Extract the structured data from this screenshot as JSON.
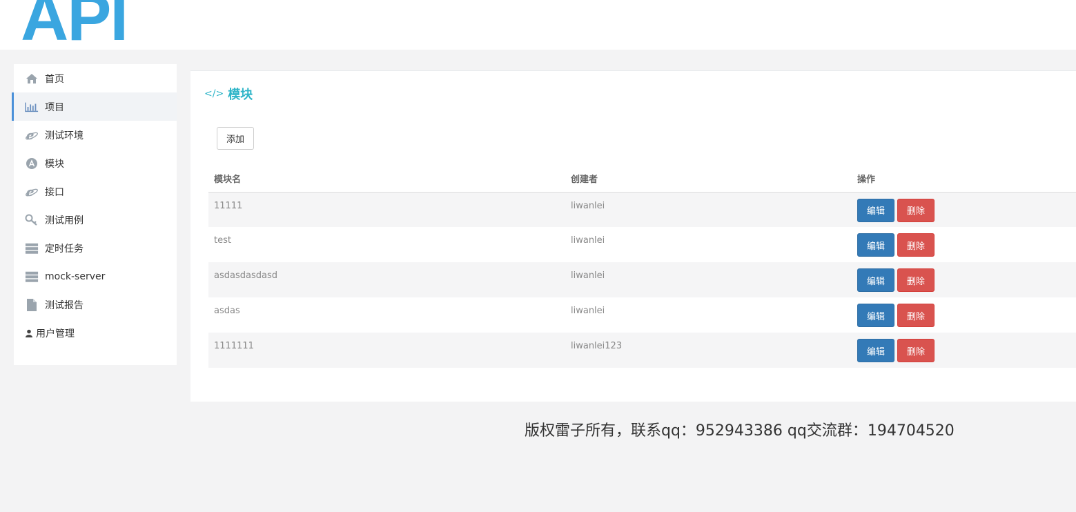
{
  "header": {
    "logo_text": "API"
  },
  "sidebar": {
    "items": [
      {
        "label": "首页",
        "icon": "home-icon"
      },
      {
        "label": "项目",
        "icon": "bar-chart-icon"
      },
      {
        "label": "测试环境",
        "icon": "ie-icon"
      },
      {
        "label": "模块",
        "icon": "app-store-icon"
      },
      {
        "label": "接口",
        "icon": "ie-icon"
      },
      {
        "label": "测试用例",
        "icon": "key-icon"
      },
      {
        "label": "定时任务",
        "icon": "server-icon"
      },
      {
        "label": "mock-server",
        "icon": "server-icon"
      },
      {
        "label": "测试报告",
        "icon": "file-icon"
      },
      {
        "label": "用户管理",
        "icon": "user-icon"
      }
    ],
    "active_index": 1
  },
  "main": {
    "title": "模块",
    "add_label": "添加",
    "table": {
      "headers": [
        "模块名",
        "创建者",
        "操作"
      ],
      "rows": [
        {
          "name": "11111",
          "creator": "liwanlei"
        },
        {
          "name": "test",
          "creator": "liwanlei"
        },
        {
          "name": "asdasdasdasd",
          "creator": "liwanlei"
        },
        {
          "name": "asdas",
          "creator": "liwanlei"
        },
        {
          "name": "1111111",
          "creator": "liwanlei123"
        }
      ],
      "edit_label": "编辑",
      "delete_label": "删除"
    }
  },
  "footer": {
    "text": "版权雷子所有，联系qq：952943386 qq交流群：194704520"
  },
  "colors": {
    "accent": "#2fb5c8",
    "logo": "#3aa6e0",
    "edit": "#337ab7",
    "delete": "#d9534f"
  }
}
